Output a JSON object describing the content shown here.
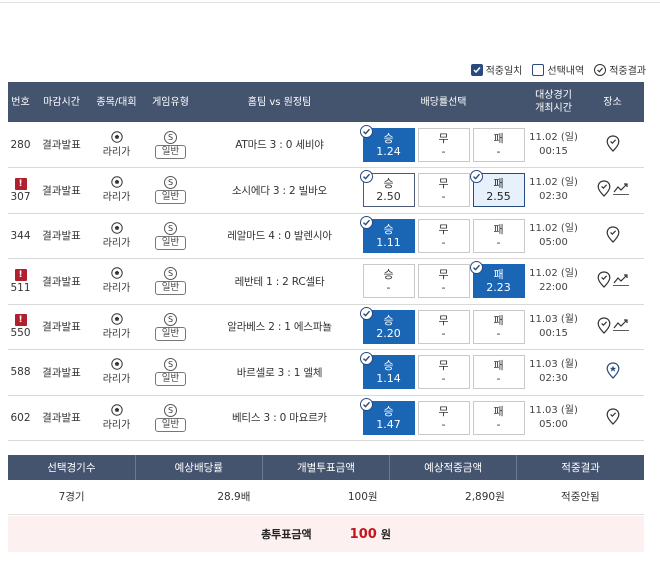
{
  "filters": [
    {
      "label": "적중일치",
      "state": "checked"
    },
    {
      "label": "선택내역",
      "state": "unchecked"
    },
    {
      "label": "적중결과",
      "state": "round"
    }
  ],
  "headers": {
    "num": "번호",
    "deadline": "마감시간",
    "league": "종목/대회",
    "gametype": "게임유형",
    "teams": "홈팀 vs 원정팀",
    "odds": "배당률선택",
    "time1": "대상경기",
    "time2": "개최시간",
    "place": "장소"
  },
  "rows": [
    {
      "num": "280",
      "alert": false,
      "deadline": "결과발표",
      "league": "라리가",
      "gtype_s": "S",
      "gtype": "일반",
      "match": "AT마드 3 : 0 세비야",
      "odds": [
        {
          "label": "승",
          "value": "1.24",
          "state": "sel"
        },
        {
          "label": "무",
          "value": "-",
          "state": ""
        },
        {
          "label": "패",
          "value": "-",
          "state": ""
        }
      ],
      "date": "11.02 (일)",
      "hour": "00:15",
      "trend": false,
      "place_special": false
    },
    {
      "num": "307",
      "alert": true,
      "deadline": "결과발표",
      "league": "라리가",
      "gtype_s": "S",
      "gtype": "일반",
      "match": "소시에다 3 : 2 빌바오",
      "odds": [
        {
          "label": "승",
          "value": "2.50",
          "state": "outline"
        },
        {
          "label": "무",
          "value": "-",
          "state": ""
        },
        {
          "label": "패",
          "value": "2.55",
          "state": "light"
        }
      ],
      "date": "11.02 (일)",
      "hour": "02:30",
      "trend": true,
      "place_special": false
    },
    {
      "num": "344",
      "alert": false,
      "deadline": "결과발표",
      "league": "라리가",
      "gtype_s": "S",
      "gtype": "일반",
      "match": "레알마드 4 : 0 발렌시아",
      "odds": [
        {
          "label": "승",
          "value": "1.11",
          "state": "sel"
        },
        {
          "label": "무",
          "value": "-",
          "state": ""
        },
        {
          "label": "패",
          "value": "-",
          "state": ""
        }
      ],
      "date": "11.02 (일)",
      "hour": "05:00",
      "trend": false,
      "place_special": false
    },
    {
      "num": "511",
      "alert": true,
      "deadline": "결과발표",
      "league": "라리가",
      "gtype_s": "S",
      "gtype": "일반",
      "match": "레반테 1 : 2 RC셀타",
      "odds": [
        {
          "label": "승",
          "value": "-",
          "state": ""
        },
        {
          "label": "무",
          "value": "-",
          "state": ""
        },
        {
          "label": "패",
          "value": "2.23",
          "state": "sel"
        }
      ],
      "date": "11.02 (일)",
      "hour": "22:00",
      "trend": true,
      "place_special": false
    },
    {
      "num": "550",
      "alert": true,
      "deadline": "결과발표",
      "league": "라리가",
      "gtype_s": "S",
      "gtype": "일반",
      "match": "알라베스 2 : 1 에스파뇰",
      "odds": [
        {
          "label": "승",
          "value": "2.20",
          "state": "sel"
        },
        {
          "label": "무",
          "value": "-",
          "state": ""
        },
        {
          "label": "패",
          "value": "-",
          "state": ""
        }
      ],
      "date": "11.03 (월)",
      "hour": "00:15",
      "trend": true,
      "place_special": false
    },
    {
      "num": "588",
      "alert": false,
      "deadline": "결과발표",
      "league": "라리가",
      "gtype_s": "S",
      "gtype": "일반",
      "match": "바르셀로 3 : 1 엘체",
      "odds": [
        {
          "label": "승",
          "value": "1.14",
          "state": "sel"
        },
        {
          "label": "무",
          "value": "-",
          "state": ""
        },
        {
          "label": "패",
          "value": "-",
          "state": ""
        }
      ],
      "date": "11.03 (월)",
      "hour": "02:30",
      "trend": false,
      "place_special": true
    },
    {
      "num": "602",
      "alert": false,
      "deadline": "결과발표",
      "league": "라리가",
      "gtype_s": "S",
      "gtype": "일반",
      "match": "베티스 3 : 0 마요르카",
      "odds": [
        {
          "label": "승",
          "value": "1.47",
          "state": "sel"
        },
        {
          "label": "무",
          "value": "-",
          "state": ""
        },
        {
          "label": "패",
          "value": "-",
          "state": ""
        }
      ],
      "date": "11.03 (월)",
      "hour": "05:00",
      "trend": false,
      "place_special": false
    }
  ],
  "alert_glyph": "!",
  "summary": {
    "headers": [
      "선택경기수",
      "예상배당률",
      "개별투표금액",
      "예상적중금액",
      "적중결과"
    ],
    "values": [
      "7경기",
      "28.9배",
      "100원",
      "2,890원",
      "적중안됨"
    ]
  },
  "total": {
    "label": "총투표금액",
    "amount": "100",
    "unit": "원"
  },
  "colors": {
    "header": "#44536e",
    "selected": "#1b65b5",
    "alert": "#b0202f",
    "total_amount": "#c4141d"
  }
}
